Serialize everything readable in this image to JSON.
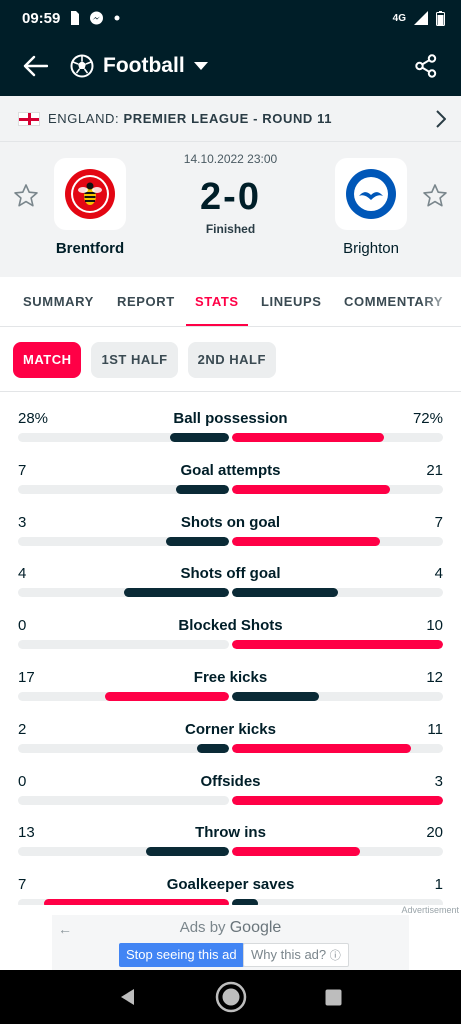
{
  "status_bar": {
    "time": "09:59",
    "network": "4G",
    "icons": [
      "sim-card-icon",
      "messenger-icon",
      "dot-icon",
      "network-4g-icon",
      "signal-icon",
      "battery-icon"
    ]
  },
  "app_bar": {
    "sport": "Football",
    "icons": [
      "back-arrow-icon",
      "football-icon",
      "dropdown-caret-icon",
      "share-icon"
    ]
  },
  "league": {
    "country": "ENGLAND:",
    "name": "PREMIER LEAGUE - ROUND 11"
  },
  "match": {
    "datetime": "14.10.2022 23:00",
    "score": "2-0",
    "status": "Finished",
    "home": {
      "name": "Brentford",
      "crest_text": "BRENTFORD FOOTBALL CLUB"
    },
    "away": {
      "name": "Brighton",
      "crest_text": "BRIGHTON & HOVE ALBION"
    }
  },
  "tabs": [
    "SUMMARY",
    "REPORT",
    "STATS",
    "LINEUPS",
    "COMMENTARY"
  ],
  "active_tab": "STATS",
  "periods": [
    "MATCH",
    "1ST HALF",
    "2ND HALF"
  ],
  "active_period": "MATCH",
  "colors": {
    "accent": "#ff0046",
    "dark": "#001e28",
    "bar_dark": "#0a2a36",
    "track": "#eceeef"
  },
  "stats": [
    {
      "name": "Ball possession",
      "home": "28%",
      "away": "72%",
      "home_value": 28,
      "away_value": 72
    },
    {
      "name": "Goal attempts",
      "home": "7",
      "away": "21",
      "home_value": 7,
      "away_value": 21
    },
    {
      "name": "Shots on goal",
      "home": "3",
      "away": "7",
      "home_value": 3,
      "away_value": 7
    },
    {
      "name": "Shots off goal",
      "home": "4",
      "away": "4",
      "home_value": 4,
      "away_value": 4
    },
    {
      "name": "Blocked Shots",
      "home": "0",
      "away": "10",
      "home_value": 0,
      "away_value": 10
    },
    {
      "name": "Free kicks",
      "home": "17",
      "away": "12",
      "home_value": 17,
      "away_value": 12
    },
    {
      "name": "Corner kicks",
      "home": "2",
      "away": "11",
      "home_value": 2,
      "away_value": 11
    },
    {
      "name": "Offsides",
      "home": "0",
      "away": "3",
      "home_value": 0,
      "away_value": 3
    },
    {
      "name": "Throw ins",
      "home": "13",
      "away": "20",
      "home_value": 13,
      "away_value": 20
    },
    {
      "name": "Goalkeeper saves",
      "home": "7",
      "away": "1",
      "home_value": 7,
      "away_value": 1
    }
  ],
  "ad": {
    "label": "Advertisement",
    "ads_by": "Ads by",
    "brand": "Google",
    "stop": "Stop seeing this ad",
    "why": "Why this ad?"
  },
  "nav": {
    "icons": [
      "back-triangle-icon",
      "home-circle-icon",
      "recents-square-icon"
    ]
  }
}
